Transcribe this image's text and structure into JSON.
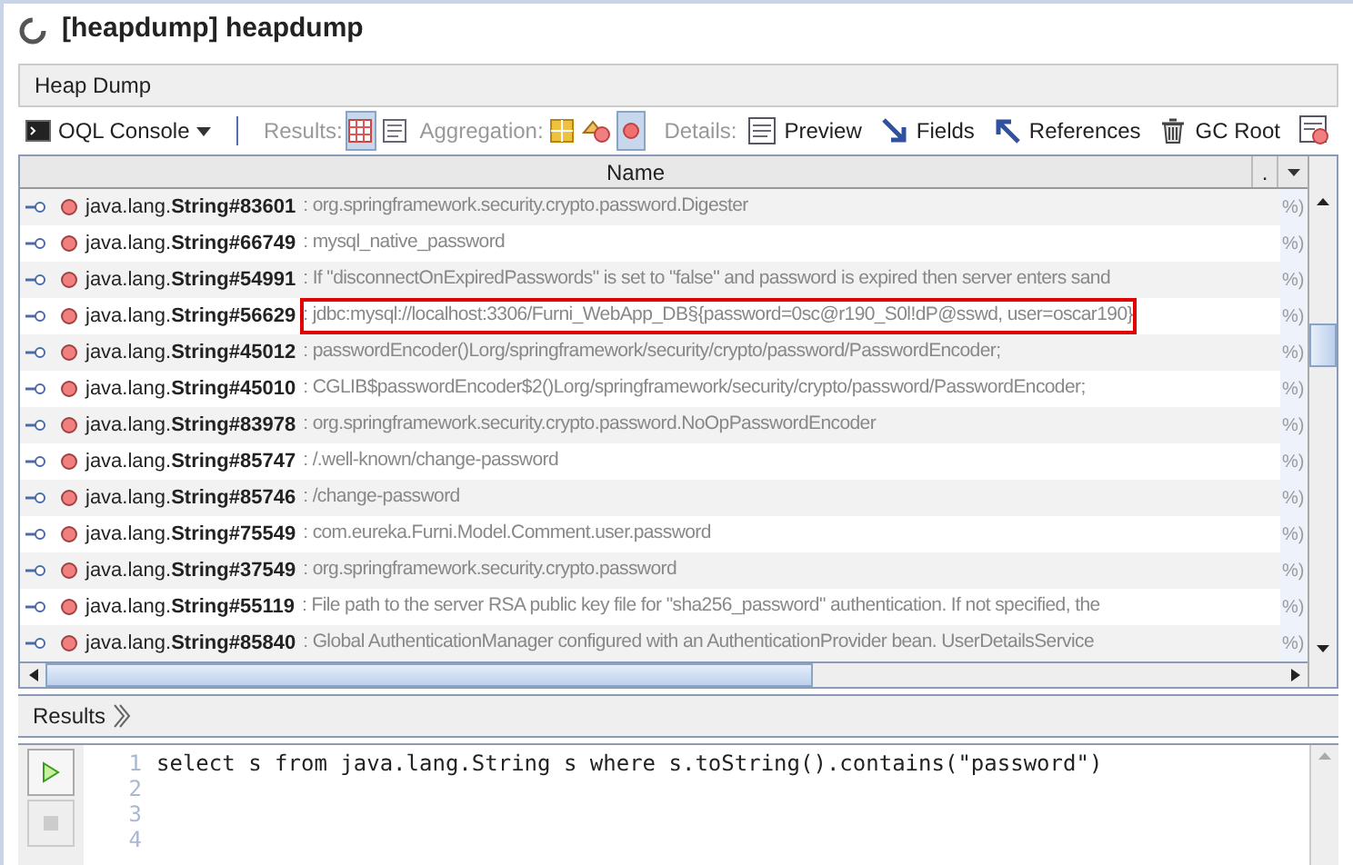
{
  "window": {
    "title": "[heapdump] heapdump"
  },
  "tab": {
    "label": "Heap Dump"
  },
  "toolbar": {
    "console": {
      "label": "OQL Console"
    },
    "groups": [
      {
        "label": "Results:",
        "items": [
          {
            "kind": "table",
            "selected": true
          },
          {
            "kind": "text",
            "selected": false
          }
        ]
      },
      {
        "label": "Aggregation:",
        "items": [
          {
            "kind": "grid",
            "selected": false
          },
          {
            "kind": "shapes",
            "selected": false
          },
          {
            "kind": "dot",
            "selected": true
          }
        ]
      }
    ],
    "details_label": "Details:",
    "details": [
      {
        "kind": "preview",
        "label": "Preview"
      },
      {
        "kind": "fields",
        "label": "Fields"
      },
      {
        "kind": "references",
        "label": "References"
      },
      {
        "kind": "gcroot",
        "label": "GC Root"
      },
      {
        "kind": "more"
      }
    ]
  },
  "table": {
    "columns": [
      "Name",
      "."
    ],
    "rows": [
      {
        "package": "java.lang.",
        "name": "String#83601",
        "value": ": org.springframework.security.crypto.password.Digester",
        "column_2": "%)",
        "highlighted": false
      },
      {
        "package": "java.lang.",
        "name": "String#66749",
        "value": ": mysql_native_password",
        "column_2": "%)",
        "highlighted": false
      },
      {
        "package": "java.lang.",
        "name": "String#54991",
        "value": ": If \"disconnectOnExpiredPasswords\" is set to \"false\" and password is expired then server enters sand",
        "column_2": "%)",
        "highlighted": false
      },
      {
        "package": "java.lang.",
        "name": "String#56629",
        "value": ": jdbc:mysql://localhost:3306/Furni_WebApp_DB§{password=0sc@r190_S0l!dP@sswd, user=oscar190}",
        "column_2": "%)",
        "highlighted": true
      },
      {
        "package": "java.lang.",
        "name": "String#45012",
        "value": ": passwordEncoder()Lorg/springframework/security/crypto/password/PasswordEncoder;",
        "column_2": "%)",
        "highlighted": false
      },
      {
        "package": "java.lang.",
        "name": "String#45010",
        "value": ": CGLIB$passwordEncoder$2()Lorg/springframework/security/crypto/password/PasswordEncoder;",
        "column_2": "%)",
        "highlighted": false
      },
      {
        "package": "java.lang.",
        "name": "String#83978",
        "value": ": org.springframework.security.crypto.password.NoOpPasswordEncoder",
        "column_2": "%)",
        "highlighted": false
      },
      {
        "package": "java.lang.",
        "name": "String#85747",
        "value": ": /.well-known/change-password",
        "column_2": "%)",
        "highlighted": false
      },
      {
        "package": "java.lang.",
        "name": "String#85746",
        "value": ": /change-password",
        "column_2": "%)",
        "highlighted": false
      },
      {
        "package": "java.lang.",
        "name": "String#75549",
        "value": ": com.eureka.Furni.Model.Comment.user.password",
        "column_2": "%)",
        "highlighted": false
      },
      {
        "package": "java.lang.",
        "name": "String#37549",
        "value": ": org.springframework.security.crypto.password",
        "column_2": "%)",
        "highlighted": false
      },
      {
        "package": "java.lang.",
        "name": "String#55119",
        "value": ": File path to the server RSA public key file for \"sha256_password\" authentication. If not specified, the",
        "column_2": "%)",
        "highlighted": false
      },
      {
        "package": "java.lang.",
        "name": "String#85840",
        "value": ": Global AuthenticationManager configured with an AuthenticationProvider bean. UserDetailsService",
        "column_2": "%)",
        "highlighted": false
      }
    ]
  },
  "results_bar": {
    "label": "Results"
  },
  "editor": {
    "line_numbers": [
      "1",
      "2",
      "3",
      "4"
    ],
    "lines": [
      "select s from java.lang.String s where s.toString().contains(\"password\")"
    ]
  }
}
